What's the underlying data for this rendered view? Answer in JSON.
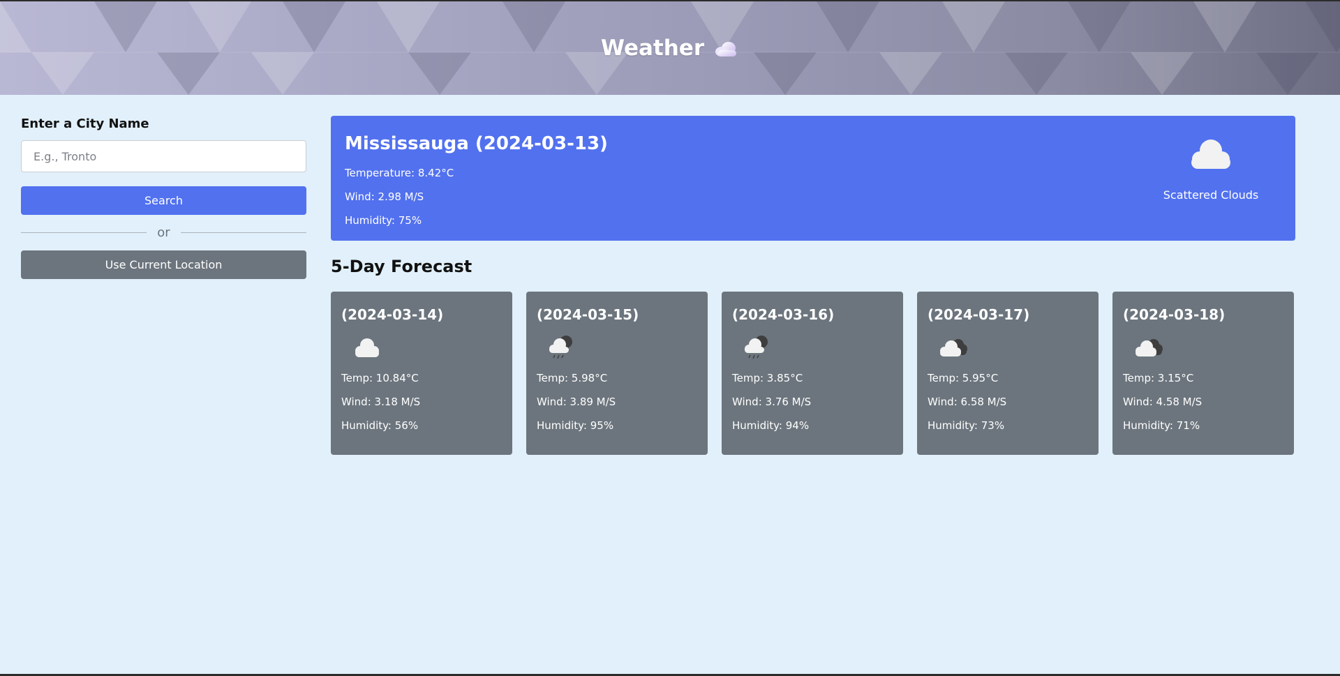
{
  "header": {
    "title": "Weather",
    "logo_icon": "cloud-logo-icon"
  },
  "sidebar": {
    "label": "Enter a City Name",
    "input": {
      "value": "",
      "placeholder": "E.g., Tronto"
    },
    "search_button": "Search",
    "divider_text": "or",
    "location_button": "Use Current Location"
  },
  "current": {
    "city_date": "Mississauga (2024-03-13)",
    "temperature": "Temperature: 8.42°C",
    "wind": "Wind: 2.98 M/S",
    "humidity": "Humidity: 75%",
    "icon": "cloud-icon",
    "description": "Scattered Clouds"
  },
  "forecast": {
    "title": "5-Day Forecast",
    "days": [
      {
        "date": "(2024-03-14)",
        "icon": "cloud-icon",
        "temp": "Temp: 10.84°C",
        "wind": "Wind: 3.18 M/S",
        "humidity": "Humidity: 56%"
      },
      {
        "date": "(2024-03-15)",
        "icon": "rain-cloud-icon",
        "temp": "Temp: 5.98°C",
        "wind": "Wind: 3.89 M/S",
        "humidity": "Humidity: 95%"
      },
      {
        "date": "(2024-03-16)",
        "icon": "rain-cloud-icon",
        "temp": "Temp: 3.85°C",
        "wind": "Wind: 3.76 M/S",
        "humidity": "Humidity: 94%"
      },
      {
        "date": "(2024-03-17)",
        "icon": "broken-clouds-icon",
        "temp": "Temp: 5.95°C",
        "wind": "Wind: 6.58 M/S",
        "humidity": "Humidity: 73%"
      },
      {
        "date": "(2024-03-18)",
        "icon": "broken-clouds-icon",
        "temp": "Temp: 3.15°C",
        "wind": "Wind: 4.58 M/S",
        "humidity": "Humidity: 71%"
      }
    ]
  },
  "colors": {
    "page_bg": "#e1f0fb",
    "primary": "#5271ef",
    "secondary": "#6c757d"
  }
}
